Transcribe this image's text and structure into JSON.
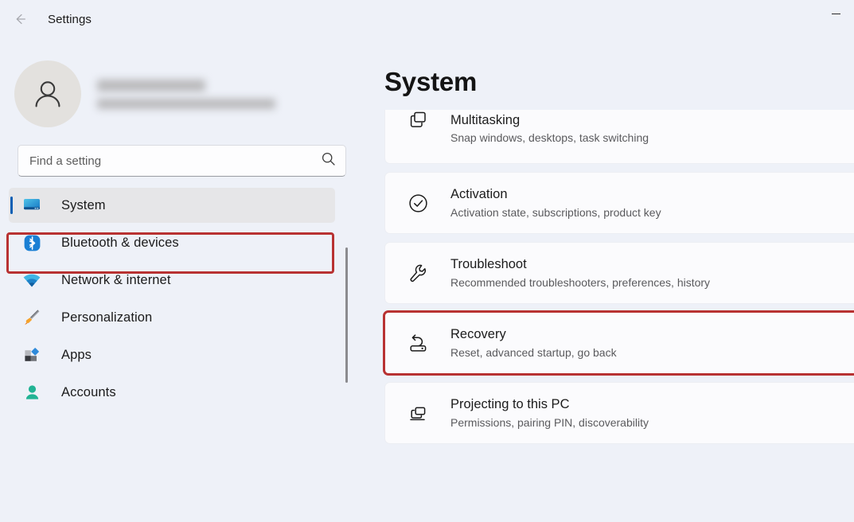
{
  "window": {
    "title": "Settings",
    "back_icon": "back-arrow-icon",
    "minimize_label": "Minimize"
  },
  "account": {
    "avatar_icon": "person-avatar-icon",
    "name": "",
    "email": "",
    "redacted": true
  },
  "search": {
    "placeholder": "Find a setting",
    "value": "",
    "icon": "search-icon"
  },
  "sidebar": {
    "items": [
      {
        "label": "System",
        "icon": "monitor-icon",
        "selected": true,
        "annotated": true
      },
      {
        "label": "Bluetooth & devices",
        "icon": "bluetooth-icon",
        "selected": false,
        "annotated": false
      },
      {
        "label": "Network & internet",
        "icon": "wifi-icon",
        "selected": false,
        "annotated": false
      },
      {
        "label": "Personalization",
        "icon": "paintbrush-icon",
        "selected": false,
        "annotated": false
      },
      {
        "label": "Apps",
        "icon": "apps-blocks-icon",
        "selected": false,
        "annotated": false
      },
      {
        "label": "Accounts",
        "icon": "person-icon",
        "selected": false,
        "annotated": false
      }
    ],
    "scrollbar": "vertical-scrollbar"
  },
  "main": {
    "heading": "System",
    "cards": [
      {
        "title": "Multitasking",
        "subtitle": "Snap windows, desktops, task switching",
        "icon": "multitasking-windows-icon",
        "clipped": true,
        "highlight": false
      },
      {
        "title": "Activation",
        "subtitle": "Activation state, subscriptions, product key",
        "icon": "check-circle-icon",
        "clipped": false,
        "highlight": false
      },
      {
        "title": "Troubleshoot",
        "subtitle": "Recommended troubleshooters, preferences, history",
        "icon": "wrench-icon",
        "clipped": false,
        "highlight": false
      },
      {
        "title": "Recovery",
        "subtitle": "Reset, advanced startup, go back",
        "icon": "recovery-drive-icon",
        "clipped": false,
        "highlight": true
      },
      {
        "title": "Projecting to this PC",
        "subtitle": "Permissions, pairing PIN, discoverability",
        "icon": "projecting-screens-icon",
        "clipped": false,
        "highlight": false
      }
    ]
  },
  "colors": {
    "page_background": "#eef1f8",
    "card_background": "#fbfbfd",
    "annotation_red": "#b83232",
    "accent_blue": "#0a5fb4",
    "selected_nav_background": "#e6e6e8",
    "text_primary": "#1b1b1b",
    "text_secondary": "#5a5a5d"
  }
}
